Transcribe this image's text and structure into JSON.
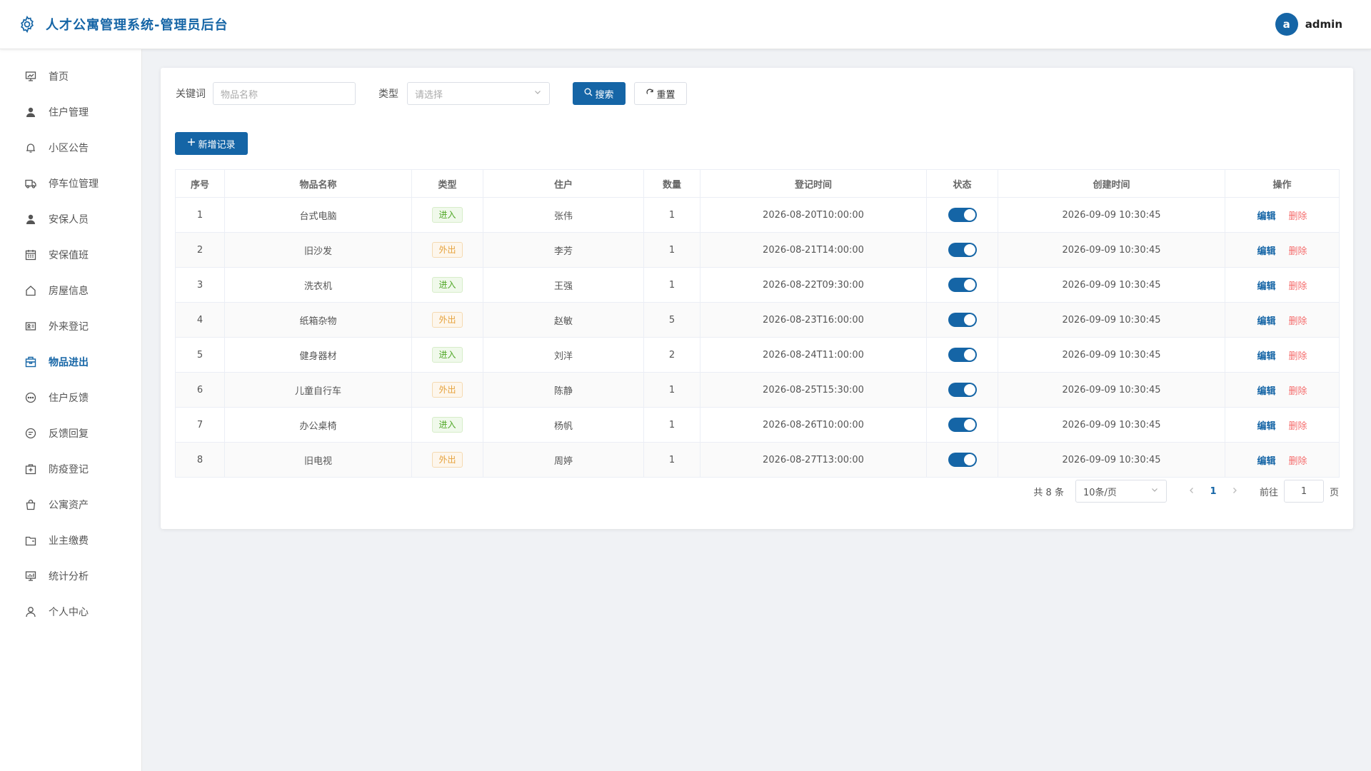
{
  "header": {
    "title": "人才公寓管理系统-管理员后台",
    "avatar_letter": "a",
    "username": "admin"
  },
  "sidebar": {
    "items": [
      {
        "label": "首页",
        "icon": "dashboard-icon",
        "active": false
      },
      {
        "label": "住户管理",
        "icon": "user-icon",
        "active": false
      },
      {
        "label": "小区公告",
        "icon": "bell-icon",
        "active": false
      },
      {
        "label": "停车位管理",
        "icon": "truck-icon",
        "active": false
      },
      {
        "label": "安保人员",
        "icon": "user-icon",
        "active": false
      },
      {
        "label": "安保值班",
        "icon": "calendar-icon",
        "active": false
      },
      {
        "label": "房屋信息",
        "icon": "house-icon",
        "active": false
      },
      {
        "label": "外来登记",
        "icon": "id-card-icon",
        "active": false
      },
      {
        "label": "物品进出",
        "icon": "box-icon",
        "active": true
      },
      {
        "label": "住户反馈",
        "icon": "chat-icon",
        "active": false
      },
      {
        "label": "反馈回复",
        "icon": "chat-reply-icon",
        "active": false
      },
      {
        "label": "防疫登记",
        "icon": "medical-box-icon",
        "active": false
      },
      {
        "label": "公寓资产",
        "icon": "bag-icon",
        "active": false
      },
      {
        "label": "业主缴费",
        "icon": "wallet-icon",
        "active": false
      },
      {
        "label": "统计分析",
        "icon": "chart-monitor-icon",
        "active": false
      },
      {
        "label": "个人中心",
        "icon": "user-outline-icon",
        "active": false
      }
    ]
  },
  "filters": {
    "keyword_label": "关键词",
    "keyword_placeholder": "物品名称",
    "type_label": "类型",
    "type_placeholder": "请选择",
    "search_label": "搜索",
    "reset_label": "重置"
  },
  "actions": {
    "add_label": "新增记录"
  },
  "table": {
    "columns": [
      "序号",
      "物品名称",
      "类型",
      "住户",
      "数量",
      "登记时间",
      "状态",
      "创建时间",
      "操作"
    ],
    "edit_label": "编辑",
    "delete_label": "删除",
    "rows": [
      {
        "index": "1",
        "name": "台式电脑",
        "type": "进入",
        "resident": "张伟",
        "qty": "1",
        "reg_time": "2026-08-20T10:00:00",
        "status": true,
        "created": "2026-09-09 10:30:45"
      },
      {
        "index": "2",
        "name": "旧沙发",
        "type": "外出",
        "resident": "李芳",
        "qty": "1",
        "reg_time": "2026-08-21T14:00:00",
        "status": true,
        "created": "2026-09-09 10:30:45"
      },
      {
        "index": "3",
        "name": "洗衣机",
        "type": "进入",
        "resident": "王强",
        "qty": "1",
        "reg_time": "2026-08-22T09:30:00",
        "status": true,
        "created": "2026-09-09 10:30:45"
      },
      {
        "index": "4",
        "name": "纸箱杂物",
        "type": "外出",
        "resident": "赵敏",
        "qty": "5",
        "reg_time": "2026-08-23T16:00:00",
        "status": true,
        "created": "2026-09-09 10:30:45"
      },
      {
        "index": "5",
        "name": "健身器材",
        "type": "进入",
        "resident": "刘洋",
        "qty": "2",
        "reg_time": "2026-08-24T11:00:00",
        "status": true,
        "created": "2026-09-09 10:30:45"
      },
      {
        "index": "6",
        "name": "儿童自行车",
        "type": "外出",
        "resident": "陈静",
        "qty": "1",
        "reg_time": "2026-08-25T15:30:00",
        "status": true,
        "created": "2026-09-09 10:30:45"
      },
      {
        "index": "7",
        "name": "办公桌椅",
        "type": "进入",
        "resident": "杨帆",
        "qty": "1",
        "reg_time": "2026-08-26T10:00:00",
        "status": true,
        "created": "2026-09-09 10:30:45"
      },
      {
        "index": "8",
        "name": "旧电视",
        "type": "外出",
        "resident": "周婷",
        "qty": "1",
        "reg_time": "2026-08-27T13:00:00",
        "status": true,
        "created": "2026-09-09 10:30:45"
      }
    ]
  },
  "pagination": {
    "total_text": "共 8 条",
    "page_size": "10条/页",
    "current_page": "1",
    "goto_label": "前往",
    "goto_value": "1",
    "page_unit": "页"
  },
  "colors": {
    "primary": "#1565a6",
    "danger": "#f56c6c",
    "tag_in": "#52a829",
    "tag_out": "#e6a23c"
  }
}
